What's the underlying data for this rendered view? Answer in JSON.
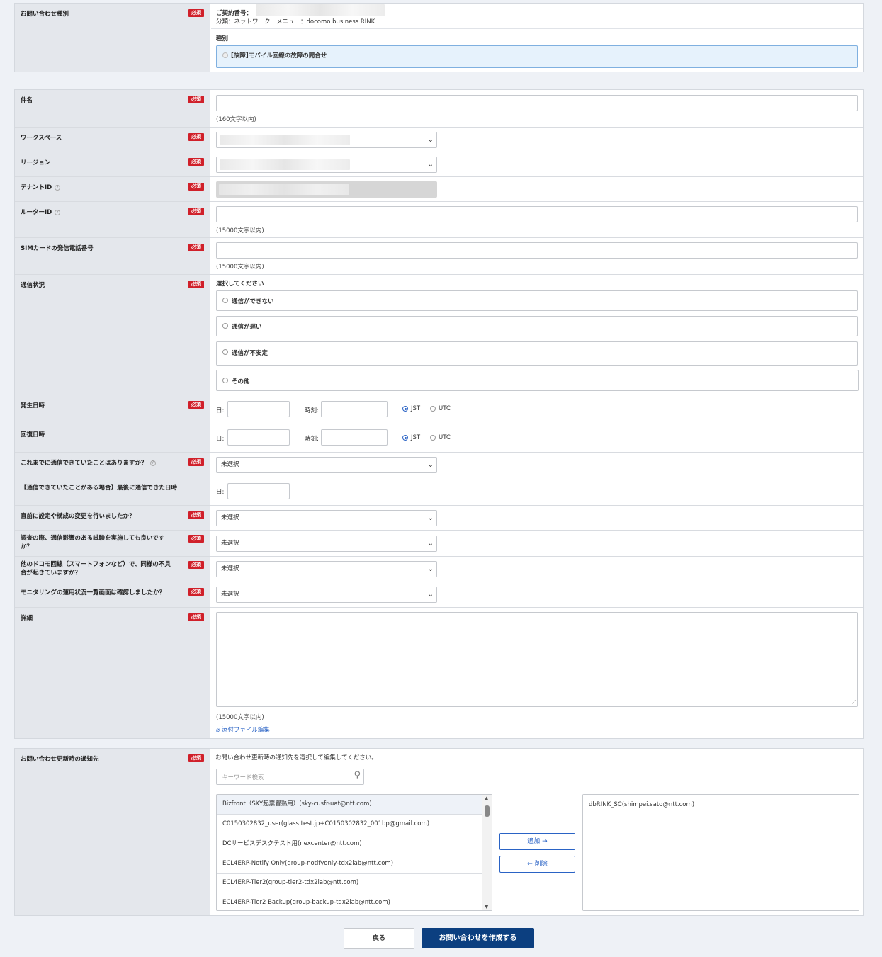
{
  "required_badge": "必須",
  "inquiry_type": {
    "label": "お問い合わせ種別",
    "contract_label": "ご契約番号：",
    "classification": "分類：ネットワーク　メニュー：docomo business RINK",
    "kind_label": "種別",
    "kind_value": "[故障]モバイル回線の故障の問合せ"
  },
  "subject": {
    "label": "件名",
    "hint": "(160文字以内)",
    "value": ""
  },
  "workspace": {
    "label": "ワークスペース"
  },
  "region": {
    "label": "リージョン"
  },
  "tenant_id": {
    "label": "テナントID"
  },
  "router_id": {
    "label": "ルーターID",
    "hint": "(15000文字以内)"
  },
  "sim_phone": {
    "label": "SIMカードの発信電話番号",
    "hint": "(15000文字以内)"
  },
  "comm_status": {
    "label": "通信状況",
    "prompt": "選択してください",
    "options": [
      "通信ができない",
      "通信が遅い",
      "通信が不安定",
      "その他"
    ]
  },
  "occurrence": {
    "label": "発生日時",
    "date_label": "日:",
    "time_label": "時刻:",
    "tz_jst": "JST",
    "tz_utc": "UTC",
    "selected_tz": "JST"
  },
  "recovery": {
    "label": "回復日時",
    "date_label": "日:",
    "time_label": "時刻:",
    "tz_jst": "JST",
    "tz_utc": "UTC",
    "selected_tz": "JST"
  },
  "q_prev_comm": {
    "label": "これまでに通信できていたことはありますか？",
    "value": "未選択"
  },
  "last_comm_date": {
    "label": "【通信できていたことがある場合】最後に通信できた日時",
    "date_label": "日:"
  },
  "q_config_change": {
    "label": "直前に設定や構成の変更を行いましたか？",
    "value": "未選択"
  },
  "q_test_ok": {
    "label": "調査の際、通信影響のある試験を実施しても良いですか？",
    "value": "未選択"
  },
  "q_other_lines": {
    "label": "他のドコモ回線（スマートフォンなど）で、同様の不具合が起きていますか？",
    "value": "未選択"
  },
  "q_monitoring": {
    "label": "モニタリングの運用状況一覧画面は確認しましたか？",
    "value": "未選択"
  },
  "details": {
    "label": "詳細",
    "hint": "(15000文字以内)",
    "attach_link": "添付ファイル編集"
  },
  "notify": {
    "label": "お問い合わせ更新時の通知先",
    "instruction": "お問い合わせ更新時の通知先を選択して編集してください。",
    "search_placeholder": "キーワード検索",
    "available": [
      "Bizfront（SKY起票習熟用）(sky-cusfr-uat@ntt.com)",
      "C0150302832_user(glass.test.jp+C0150302832_001bp@gmail.com)",
      "DCサービスデスクテスト用(nexcenter@ntt.com)",
      "ECL4ERP-Notify Only(group-notifyonly-tdx2lab@ntt.com)",
      "ECL4ERP-Tier2(group-tier2-tdx2lab@ntt.com)",
      "ECL4ERP-Tier2 Backup(group-backup-tdx2lab@ntt.com)"
    ],
    "selected": [
      "dbRINK_SC(shimpei.sato@ntt.com)"
    ],
    "add_label": "追加 →",
    "remove_label": "← 削除"
  },
  "actions": {
    "back": "戻る",
    "submit": "お問い合わせを作成する"
  },
  "colors": {
    "required": "#d0202a",
    "primary": "#0c3f80",
    "accent": "#2a63c5",
    "label_bg": "#e4e7ec"
  }
}
